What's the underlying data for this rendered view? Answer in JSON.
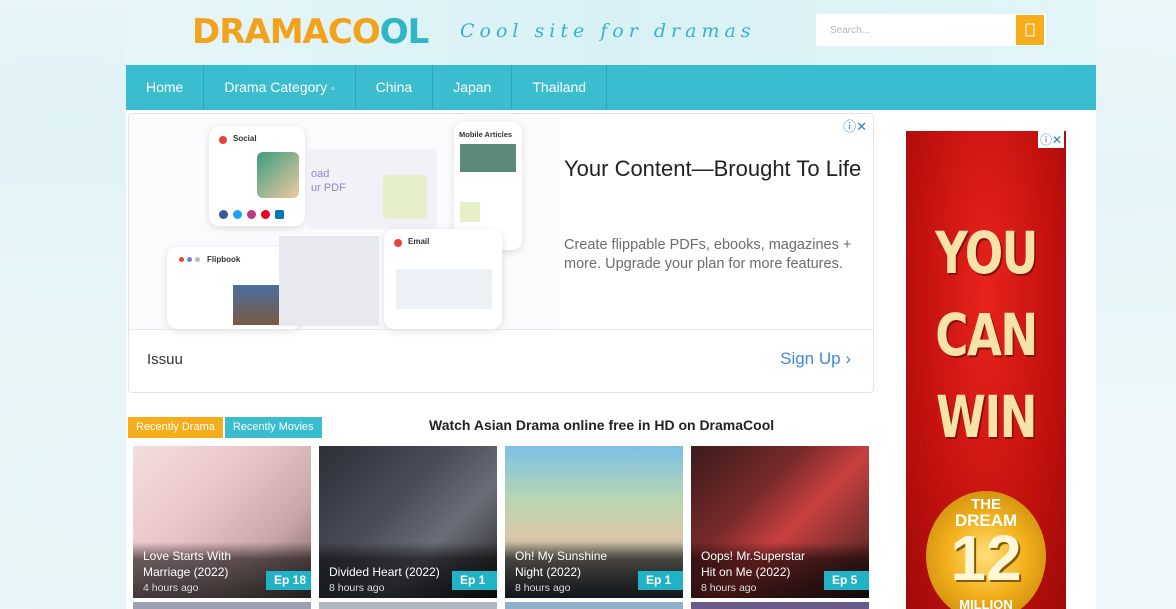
{
  "header": {
    "logo": {
      "part1": "DRAMA",
      "part2": "CO",
      "part3": "OL"
    },
    "tagline": "Cool site for dramas",
    "search_placeholder": "Search..."
  },
  "nav": [
    {
      "label": "Home"
    },
    {
      "label": "Drama Category"
    },
    {
      "label": "China"
    },
    {
      "label": "Japan"
    },
    {
      "label": "Thailand"
    }
  ],
  "ad": {
    "card_social": "Social",
    "card_mobile": "Mobile Articles",
    "card_email": "Email",
    "card_flipbook": "Flipbook",
    "card_upload": "oad\nur PDF",
    "title": "Your Content—Brought To Life",
    "description": "Create flippable PDFs, ebooks, magazines + more. Upgrade your plan for more features.",
    "brand": "Issuu",
    "cta": "Sign Up"
  },
  "tabs": [
    {
      "label": "Recently Drama",
      "active": true
    },
    {
      "label": "Recently Movies",
      "active": false
    }
  ],
  "section_title": "Watch Asian Drama online free in HD on DramaCool",
  "dramas": [
    {
      "title": "Love Starts With Marriage (2022)",
      "time": "4 hours ago",
      "ep": "Ep 18"
    },
    {
      "title": "Divided Heart (2022)",
      "time": "8 hours ago",
      "ep": "Ep 1"
    },
    {
      "title": "Oh! My Sunshine Night (2022)",
      "time": "8 hours ago",
      "ep": "Ep 1"
    },
    {
      "title": "Oops! Mr.Superstar Hit on Me (2022)",
      "time": "8 hours ago",
      "ep": "Ep 5"
    }
  ],
  "sidebar_ad": {
    "lines": [
      "YOU",
      "CAN",
      "WIN"
    ],
    "badge_the": "THE",
    "badge_dream": "DREAM",
    "badge_num": "12",
    "badge_million": "MILLION"
  },
  "colors": {
    "accent": "#3bbdd0",
    "highlight": "#f6ad1c",
    "ep_badge": "#21b3c5"
  }
}
